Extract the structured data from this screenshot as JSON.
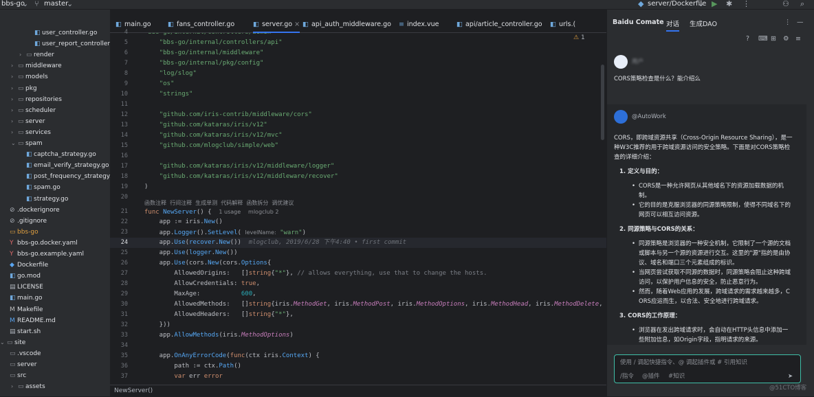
{
  "topbar": {
    "project": "bbs-go",
    "branch": "master",
    "run_config": "server/Dockerfile"
  },
  "tree": [
    {
      "label": "user_controller.go",
      "type": "go",
      "indent": 3,
      "arrow": ""
    },
    {
      "label": "user_report_controller.go",
      "type": "go",
      "indent": 3,
      "arrow": ""
    },
    {
      "label": "render",
      "type": "dir",
      "indent": 2,
      "arrow": "›"
    },
    {
      "label": "middleware",
      "type": "dir",
      "indent": 1,
      "arrow": "›"
    },
    {
      "label": "models",
      "type": "dir",
      "indent": 1,
      "arrow": "›"
    },
    {
      "label": "pkg",
      "type": "dir",
      "indent": 1,
      "arrow": "›"
    },
    {
      "label": "repositories",
      "type": "dir",
      "indent": 1,
      "arrow": "›"
    },
    {
      "label": "scheduler",
      "type": "dir",
      "indent": 1,
      "arrow": "›"
    },
    {
      "label": "server",
      "type": "dir",
      "indent": 1,
      "arrow": "›"
    },
    {
      "label": "services",
      "type": "dir",
      "indent": 1,
      "arrow": "›"
    },
    {
      "label": "spam",
      "type": "dir",
      "indent": 1,
      "arrow": "⌄"
    },
    {
      "label": "captcha_strategy.go",
      "type": "go",
      "indent": 2,
      "arrow": ""
    },
    {
      "label": "email_verify_strategy.go",
      "type": "go",
      "indent": 2,
      "arrow": ""
    },
    {
      "label": "post_frequency_strategy.go",
      "type": "go",
      "indent": 2,
      "arrow": ""
    },
    {
      "label": "spam.go",
      "type": "go",
      "indent": 2,
      "arrow": ""
    },
    {
      "label": "strategy.go",
      "type": "go",
      "indent": 2,
      "arrow": ""
    },
    {
      "label": ".dockerignore",
      "type": "ign",
      "indent": 0,
      "arrow": ""
    },
    {
      "label": ".gitignore",
      "type": "ign",
      "indent": 0,
      "arrow": ""
    },
    {
      "label": "bbs-go",
      "type": "main",
      "indent": 0,
      "arrow": ""
    },
    {
      "label": "bbs-go.docker.yaml",
      "type": "yml",
      "indent": 0,
      "arrow": ""
    },
    {
      "label": "bbs-go.example.yaml",
      "type": "yml",
      "indent": 0,
      "arrow": ""
    },
    {
      "label": "Dockerfile",
      "type": "doc",
      "indent": 0,
      "arrow": ""
    },
    {
      "label": "go.mod",
      "type": "go",
      "indent": 0,
      "arrow": ""
    },
    {
      "label": "LICENSE",
      "type": "sh",
      "indent": 0,
      "arrow": ""
    },
    {
      "label": "main.go",
      "type": "go",
      "indent": 0,
      "arrow": ""
    },
    {
      "label": "Makefile",
      "type": "mk",
      "indent": 0,
      "arrow": ""
    },
    {
      "label": "README.md",
      "type": "md",
      "indent": 0,
      "arrow": ""
    },
    {
      "label": "start.sh",
      "type": "sh",
      "indent": 0,
      "arrow": ""
    },
    {
      "label": "site",
      "type": "dir",
      "indent": -1,
      "arrow": "⌄"
    },
    {
      "label": ".vscode",
      "type": "dir",
      "indent": 0,
      "arrow": ""
    },
    {
      "label": "server",
      "type": "dir",
      "indent": 0,
      "arrow": ""
    },
    {
      "label": "src",
      "type": "dir",
      "indent": 0,
      "arrow": ""
    },
    {
      "label": "assets",
      "type": "dir",
      "indent": 1,
      "arrow": "›"
    }
  ],
  "tabs": [
    "main.go",
    "fans_controller.go",
    "server.go",
    "api_auth_middleware.go",
    "index.vue",
    "api/article_controller.go",
    "urls.("
  ],
  "line_numbers": [
    "4",
    "5",
    "6",
    "7",
    "8",
    "9",
    "10",
    "11",
    "12",
    "13",
    "14",
    "15",
    "16",
    "17",
    "18",
    "19",
    "20",
    "",
    "21",
    "22",
    "23",
    "24",
    "25",
    "26",
    "27",
    "28",
    "29",
    "30",
    "31",
    "32",
    "33",
    "34",
    "35",
    "36",
    "37"
  ],
  "codelens": "函数注释  行间注释  生成单测  代码解释  函数拆分  调优建议",
  "inspection_count": "1",
  "status_breadcrumb": "NewServer()",
  "code_hints": {
    "usages": "1 usage",
    "author": "mlogclub 2",
    "param_name": "levelName:",
    "blame": "mlogclub, 2019/6/28 下午4:40 • first commit"
  },
  "chat": {
    "app_name": "Baidu Comate",
    "tab_chat": "对话",
    "tab_gen": "生成DAO",
    "username": "用户",
    "question": "CORS策略检查是什么？能介绍么",
    "bot_name": "@AutoWork",
    "intro": [
      "CORS，即跨域资源共享（Cross-Origin Resource Sharing），是一",
      "种W3C推荐的用于跨域资源访问的安全策略。下面是对CORS策略检",
      "查的详细介绍："
    ],
    "s1_title": "1. 定义与目的：",
    "s1_b1": [
      "CORS是一种允许网页从其他域名下的资源加载数据的机",
      "制。"
    ],
    "s1_b2": [
      "它的目的是克服浏览器的同源策略限制，使得不同域名下的",
      "网页可以相互访问资源。"
    ],
    "s2_title": "2. 同源策略与CORS的关系：",
    "s2_b1": [
      "同源策略是浏览器的一种安全机制，它限制了一个源的文档",
      "或脚本与另一个源的资源进行交互。这里的\"源\"指的是由协",
      "议、域名和端口三个元素组成的标识。"
    ],
    "s2_b2": [
      "当网页尝试获取不同源的数据时，同源策略会阻止这种跨域",
      "访问，以保护用户信息的安全，防止恶意行为。"
    ],
    "s2_b3": [
      "然而，随着Web应用的发展，跨域请求的需求越来越多，C",
      "ORS应运而生，以合法、安全地进行跨域请求。"
    ],
    "s3_title": "3. CORS的工作原理：",
    "s3_b1": [
      "浏览器在发出跨域请求时，会自动在HTTP头信息中添加一",
      "些附加信息，如Origin字段，指明请求的来源。"
    ],
    "input_placeholder": "使用 / 调起快捷指令、@ 调起插件或 # 引用知识",
    "chip_cmd": "/指令",
    "chip_plugin": "@插件",
    "chip_know": "#知识",
    "watermark": "@51CTO博客"
  }
}
